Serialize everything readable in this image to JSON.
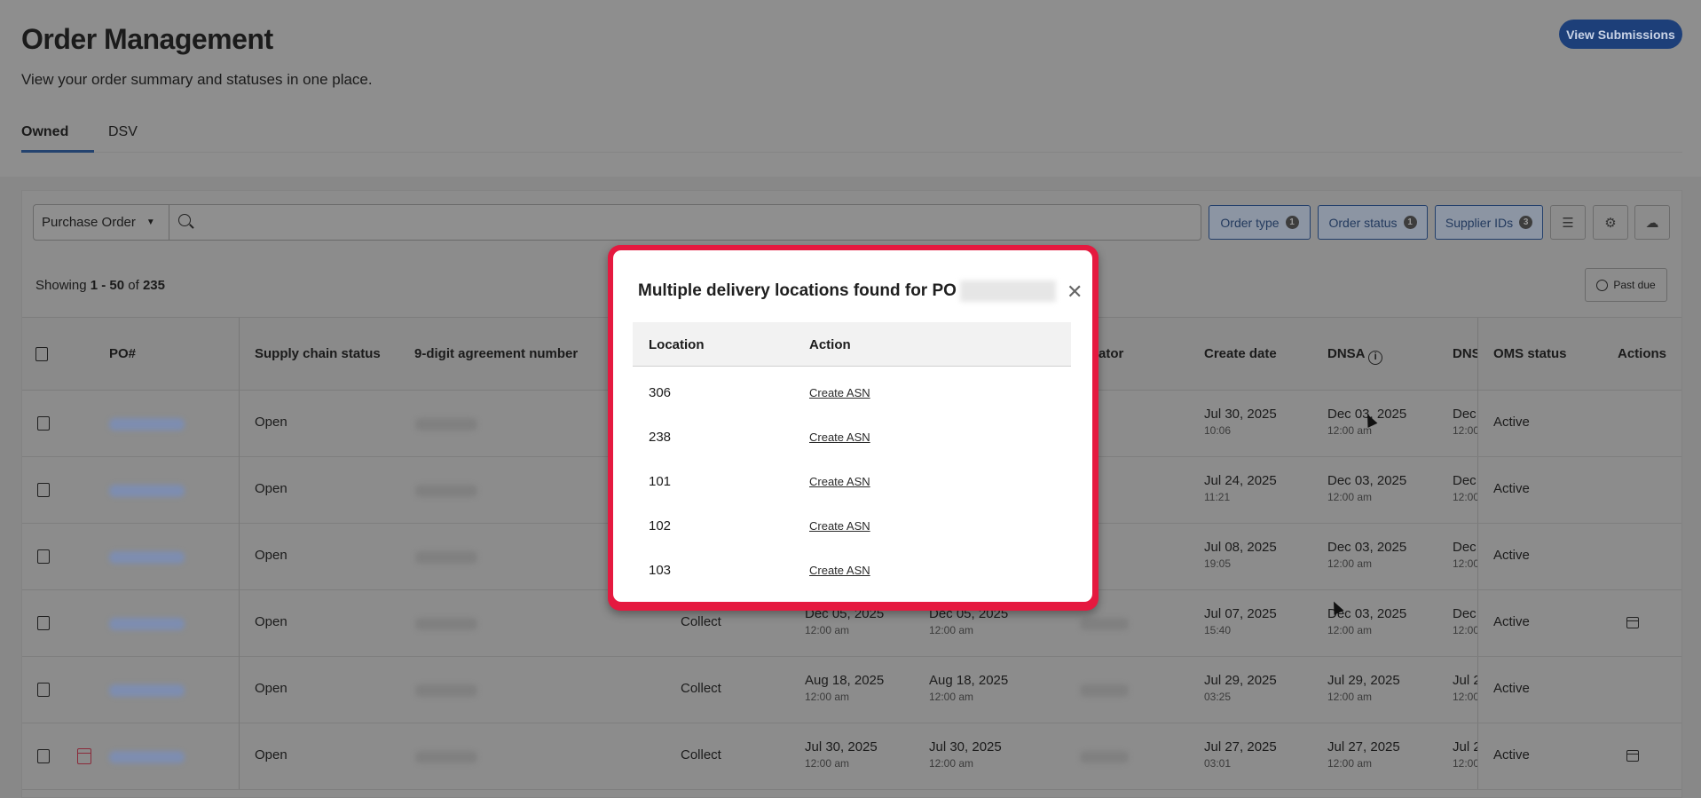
{
  "header": {
    "title": "Order Management",
    "subtitle": "View your order summary and statuses in one place.",
    "view_submissions": "View Submissions"
  },
  "tabs": [
    {
      "label": "Owned"
    },
    {
      "label": "DSV"
    }
  ],
  "toolbar": {
    "search_type": "Purchase Order",
    "search_placeholder": "",
    "filters": [
      {
        "label": "Order type",
        "count": "1"
      },
      {
        "label": "Order status",
        "count": "1"
      },
      {
        "label": "Supplier IDs",
        "count": "3"
      }
    ]
  },
  "summary": {
    "prefix": "Showing ",
    "range": "1 - 50",
    "of": " of ",
    "total": "235"
  },
  "past_due": "Past due",
  "table": {
    "headers": {
      "po": "PO#",
      "supply": "Supply chain status",
      "agreement": "9-digit agreement number",
      "creator": "ator",
      "create": "Create date",
      "dnsa": "DNSA",
      "dns": "DNS",
      "oms": "OMS status",
      "actions": "Actions"
    },
    "rows": [
      {
        "supply": "Open",
        "type": "",
        "d1": "",
        "t1": "",
        "d2": "",
        "t2": "",
        "create": "Jul 30, 2025",
        "create_t": "10:06",
        "dnsa": "Dec 03, 2025",
        "dnsa_t": "12:00 am",
        "dns": "Dec",
        "dns_t": "12:00",
        "oms": "Active",
        "box": false,
        "cal": false
      },
      {
        "supply": "Open",
        "type": "",
        "d1": "",
        "t1": "",
        "d2": "",
        "t2": "",
        "create": "Jul 24, 2025",
        "create_t": "11:21",
        "dnsa": "Dec 03, 2025",
        "dnsa_t": "12:00 am",
        "dns": "Dec",
        "dns_t": "12:00",
        "oms": "Active",
        "box": false,
        "cal": false
      },
      {
        "supply": "Open",
        "type": "",
        "d1": "",
        "t1": "",
        "d2": "",
        "t2": "",
        "create": "Jul 08, 2025",
        "create_t": "19:05",
        "dnsa": "Dec 03, 2025",
        "dnsa_t": "12:00 am",
        "dns": "Dec",
        "dns_t": "12:00",
        "oms": "Active",
        "box": false,
        "cal": false
      },
      {
        "supply": "Open",
        "type": "Collect",
        "d1": "Dec 05, 2025",
        "t1": "12:00 am",
        "d2": "Dec 05, 2025",
        "t2": "12:00 am",
        "create": "Jul 07, 2025",
        "create_t": "15:40",
        "dnsa": "Dec 03, 2025",
        "dnsa_t": "12:00 am",
        "dns": "Dec",
        "dns_t": "12:00",
        "oms": "Active",
        "box": true,
        "cal": false
      },
      {
        "supply": "Open",
        "type": "Collect",
        "d1": "Aug 18, 2025",
        "t1": "12:00 am",
        "d2": "Aug 18, 2025",
        "t2": "12:00 am",
        "create": "Jul 29, 2025",
        "create_t": "03:25",
        "dnsa": "Jul 29, 2025",
        "dnsa_t": "12:00 am",
        "dns": "Jul 2",
        "dns_t": "12:00",
        "oms": "Active",
        "box": false,
        "cal": false
      },
      {
        "supply": "Open",
        "type": "Collect",
        "d1": "Jul 30, 2025",
        "t1": "12:00 am",
        "d2": "Jul 30, 2025",
        "t2": "12:00 am",
        "create": "Jul 27, 2025",
        "create_t": "03:01",
        "dnsa": "Jul 27, 2025",
        "dnsa_t": "12:00 am",
        "dns": "Jul 2",
        "dns_t": "12:00",
        "oms": "Active",
        "box": true,
        "cal": true
      }
    ]
  },
  "modal": {
    "title": "Multiple delivery locations found for PO",
    "headers": {
      "location": "Location",
      "action": "Action"
    },
    "rows": [
      {
        "location": "306",
        "action": "Create ASN"
      },
      {
        "location": "238",
        "action": "Create ASN"
      },
      {
        "location": "101",
        "action": "Create ASN"
      },
      {
        "location": "102",
        "action": "Create ASN"
      },
      {
        "location": "103",
        "action": "Create ASN"
      }
    ]
  },
  "colors": {
    "accent": "#1d3f79",
    "highlight": "#e5193f"
  }
}
